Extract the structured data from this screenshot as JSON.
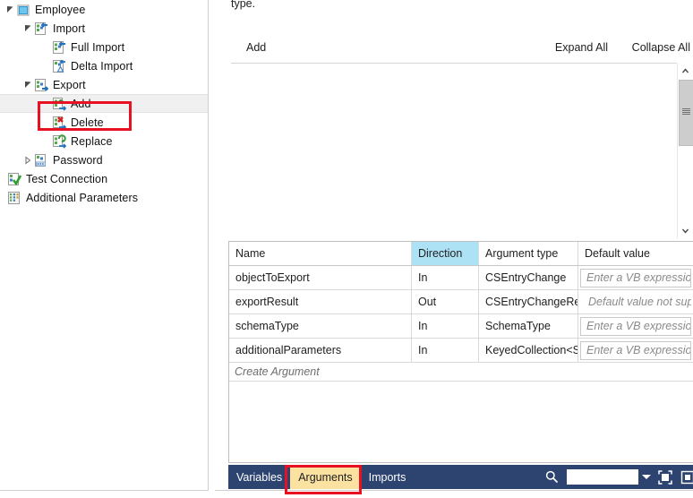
{
  "app": {
    "accent_blue": "#2e4470",
    "highlight_red": "#e81123",
    "active_tab_bg": "#fbe2a0",
    "direction_header_bg": "#ade2f5"
  },
  "tree": {
    "items": [
      {
        "label": "Employee",
        "indent": 0,
        "expander": "expanded",
        "icon": "object-square-icon",
        "selected": false
      },
      {
        "label": "Import",
        "indent": 1,
        "expander": "expanded",
        "icon": "import-icon",
        "selected": false
      },
      {
        "label": "Full Import",
        "indent": 2,
        "expander": "none",
        "icon": "full-import-icon",
        "selected": false
      },
      {
        "label": "Delta Import",
        "indent": 2,
        "expander": "none",
        "icon": "delta-import-icon",
        "selected": false
      },
      {
        "label": "Export",
        "indent": 1,
        "expander": "expanded",
        "icon": "export-icon",
        "selected": false
      },
      {
        "label": "Add",
        "indent": 2,
        "expander": "none",
        "icon": "export-add-icon",
        "selected": true
      },
      {
        "label": "Delete",
        "indent": 2,
        "expander": "none",
        "icon": "export-delete-icon",
        "selected": false
      },
      {
        "label": "Replace",
        "indent": 2,
        "expander": "none",
        "icon": "export-replace-icon",
        "selected": false
      },
      {
        "label": "Password",
        "indent": 1,
        "expander": "collapsed",
        "icon": "password-icon",
        "selected": false
      },
      {
        "label": "Test Connection",
        "indent": 0,
        "expander": "none",
        "icon": "test-connection-icon",
        "selected": false
      },
      {
        "label": "Additional Parameters",
        "indent": 0,
        "expander": "none",
        "icon": "additional-params-icon",
        "selected": false
      }
    ]
  },
  "designer": {
    "description_text": "type.",
    "add_label": "Add",
    "expand_all_label": "Expand All",
    "collapse_all_label": "Collapse All"
  },
  "grid": {
    "headers": [
      "Name",
      "Direction",
      "Argument type",
      "Default value"
    ],
    "rows": [
      {
        "name": "objectToExport",
        "direction": "In",
        "type": "CSEntryChange",
        "default": "Enter a VB expression",
        "default_boxed": true
      },
      {
        "name": "exportResult",
        "direction": "Out",
        "type": "CSEntryChangeRes",
        "default": "Default value not suppor",
        "default_boxed": false
      },
      {
        "name": "schemaType",
        "direction": "In",
        "type": "SchemaType",
        "default": "Enter a VB expression",
        "default_boxed": true
      },
      {
        "name": "additionalParameters",
        "direction": "In",
        "type": "KeyedCollection<S",
        "default": "Enter a VB expression",
        "default_boxed": true
      }
    ],
    "create_argument_label": "Create Argument"
  },
  "tabbar": {
    "tabs": [
      {
        "label": "Variables",
        "active": false
      },
      {
        "label": "Arguments",
        "active": true
      },
      {
        "label": "Imports",
        "active": false
      }
    ],
    "search_value": "",
    "search_placeholder": ""
  }
}
